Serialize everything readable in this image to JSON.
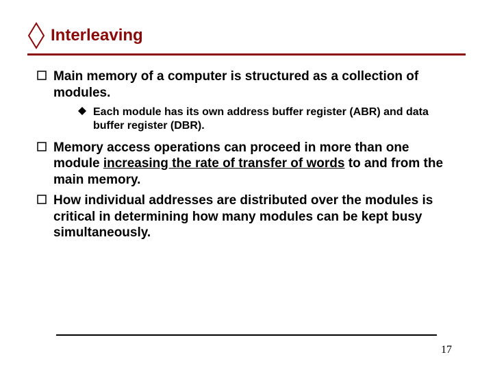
{
  "title": "Interleaving",
  "bullets": {
    "b1": "Main memory of a computer is structured as a collection of modules.",
    "b1a": "Each module has its own address buffer register (ABR) and data buffer register (DBR).",
    "b2_pre": "Memory access operations can proceed in more than one module ",
    "b2_u": "increasing the rate of transfer of words",
    "b2_post": " to and from the main memory.",
    "b3": "How individual addresses are distributed over the modules is critical in determining how many modules can be kept busy simultaneously."
  },
  "page_number": "17"
}
